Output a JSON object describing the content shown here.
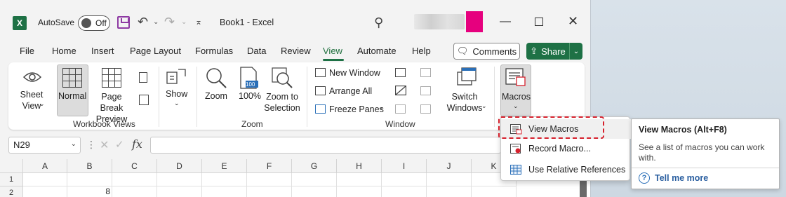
{
  "window": {
    "app_logo": "X",
    "autosave_label": "AutoSave",
    "autosave_state": "Off",
    "title": "Book1  -  Excel",
    "min_symbol": "—",
    "close_symbol": "✕"
  },
  "tabs": [
    {
      "label": "File"
    },
    {
      "label": "Home"
    },
    {
      "label": "Insert"
    },
    {
      "label": "Page Layout"
    },
    {
      "label": "Formulas"
    },
    {
      "label": "Data"
    },
    {
      "label": "Review"
    },
    {
      "label": "View"
    },
    {
      "label": "Automate"
    },
    {
      "label": "Help"
    }
  ],
  "active_tab": "View",
  "comments_label": "Comments",
  "share_label": "Share",
  "ribbon": {
    "sheet_view": "Sheet\nView",
    "normal": "Normal",
    "page_break_preview": "Page Break\nPreview",
    "workbook_views": "Workbook Views",
    "show": "Show",
    "zoom": "Zoom",
    "zoom_100": "100%",
    "zoom_badge": "100",
    "zoom_to_selection": "Zoom to\nSelection",
    "zoom_group": "Zoom",
    "new_window": "New Window",
    "arrange_all": "Arrange All",
    "freeze_panes": "Freeze Panes",
    "switch_windows": "Switch\nWindows",
    "window_group": "Window",
    "macros": "Macros"
  },
  "formula_bar": {
    "name_box": "N29",
    "fx": "fx",
    "formula": ""
  },
  "grid": {
    "columns": [
      "A",
      "B",
      "C",
      "D",
      "E",
      "F",
      "G",
      "H",
      "I",
      "J",
      "K"
    ],
    "rows": [
      "1",
      "2"
    ],
    "cells": {
      "B2": "8"
    }
  },
  "macros_menu": {
    "items": [
      {
        "label": "View Macros",
        "underline": "V"
      },
      {
        "label": "Record Macro...",
        "underline": "R"
      },
      {
        "label": "Use Relative References",
        "underline": "U"
      }
    ]
  },
  "tooltip": {
    "title": "View Macros (Alt+F8)",
    "description": "See a list of macros you can work with.",
    "help_link": "Tell me more"
  },
  "colors": {
    "accent_green": "#1e7145",
    "highlight_red": "#d6202c",
    "link_blue": "#2a5fa0"
  }
}
